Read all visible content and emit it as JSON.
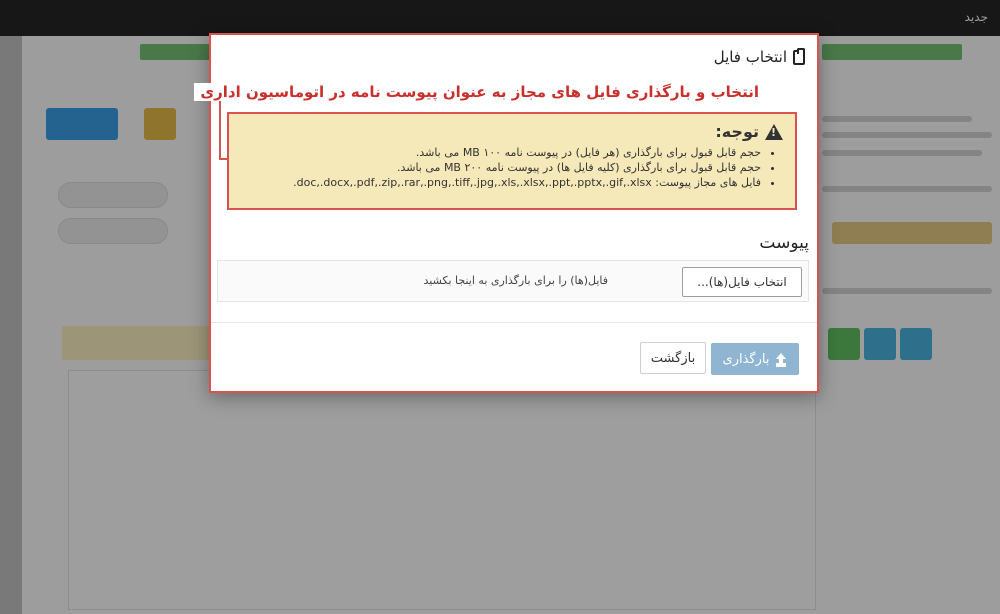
{
  "app": {
    "brand": "جدید"
  },
  "modal": {
    "title": "انتخاب فایل",
    "annotation": "انتخاب و بارگذاری فایل های مجاز به عنوان پیوست نامه در اتوماسیون اداری",
    "alert": {
      "title": "توجه:",
      "items": [
        "حجم قابل قبول برای بارگذاری (هر فایل) در پیوست نامه ۱۰۰ MB می باشد.",
        "حجم قابل قبول برای بارگذاری (کلیه فایل ها) در پیوست نامه ۲۰۰ MB می باشد.",
        "فایل های مجاز پیوست: doc,.docx,.pdf,.zip,.rar,.png,.tiff,.jpg,.xls,.xlsx,.ppt,.pptx,.gif,.xlsx."
      ]
    },
    "section_title": "پیوست",
    "choose_label": "انتخاب فایل(ها)...",
    "drop_hint": "فایل(ها) را برای بارگذاری به اینجا بکشید",
    "upload_label": "بارگذاری",
    "back_label": "بازگشت"
  },
  "colors": {
    "accent_red": "#d9534f",
    "alert_bg": "#f5e8b9",
    "upload_bg": "#8fb5d3"
  }
}
